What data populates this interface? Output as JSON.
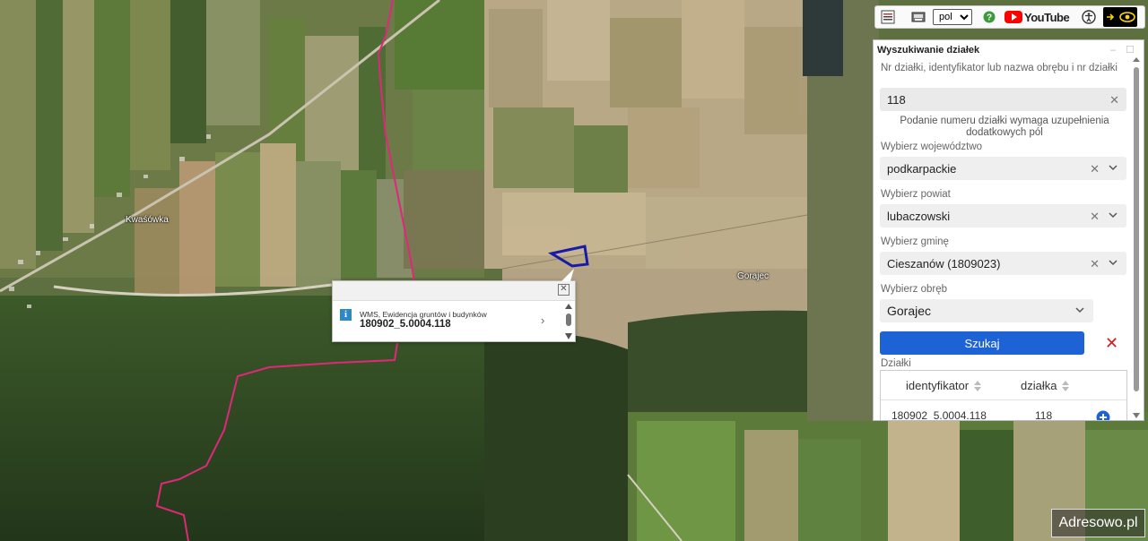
{
  "map": {
    "place_labels": [
      {
        "name": "Kwaśówka"
      },
      {
        "name": "Gorajec"
      }
    ]
  },
  "toolbar": {
    "language_value": "pol",
    "language_options": [
      "pol"
    ],
    "youtube_label": "YouTube",
    "icons": [
      "list-icon",
      "print-icon",
      "help-icon",
      "youtube-icon",
      "accessibility-icon",
      "visibility-icon"
    ]
  },
  "popup": {
    "layer_name": "WMS, Ewidencja gruntów i budynków",
    "feature_id": "180902_5.0004.118"
  },
  "search_panel": {
    "title": "Wyszukiwanie działek",
    "query_label": "Nr działki, identyfikator lub nazwa obrębu i nr działki",
    "query_value": "118",
    "note": "Podanie numeru działki wymaga uzupełnienia dodatkowych pól",
    "voivodeship_label": "Wybierz województwo",
    "voivodeship_value": "podkarpackie",
    "county_label": "Wybierz powiat",
    "county_value": "lubaczowski",
    "commune_label": "Wybierz gminę",
    "commune_value": "Cieszanów (1809023)",
    "precinct_label": "Wybierz obręb",
    "precinct_value": "Gorajec",
    "search_button": "Szukaj",
    "results_label": "Działki",
    "columns": [
      "identyfikator",
      "działka"
    ],
    "rows": [
      {
        "identyfikator": "180902_5.0004.118",
        "dzialka": "118"
      }
    ]
  },
  "brand": "Adresowo.pl",
  "colors": {
    "primary_button": "#1e63d6",
    "boundary_line": "#e0287a",
    "parcel_outline": "#1a1aa8",
    "clear_icon": "#d02020"
  }
}
